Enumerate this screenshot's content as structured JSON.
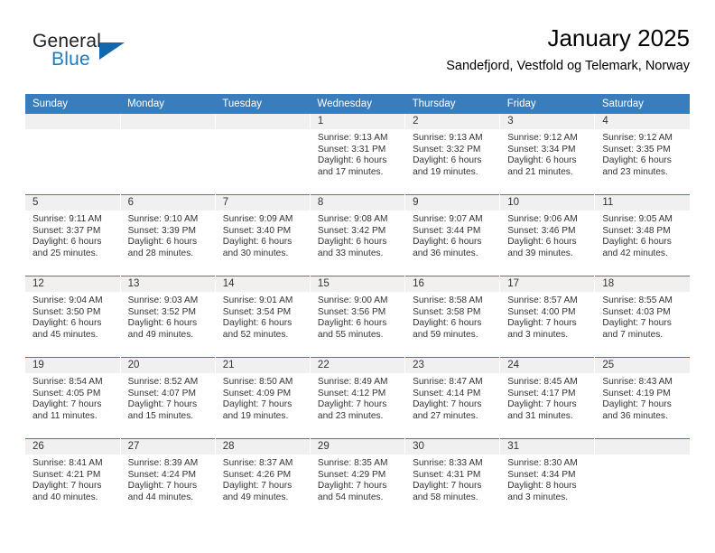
{
  "logo": {
    "text_primary": "General",
    "text_secondary": "Blue",
    "icon": "triangle-icon",
    "color_primary": "#231f20",
    "color_secondary": "#1b7bc4",
    "color_triangle": "#1267ad"
  },
  "header": {
    "title": "January 2025",
    "subtitle": "Sandefjord, Vestfold og Telemark, Norway"
  },
  "theme": {
    "header_bar": "#3a7dbd",
    "daynum_band": "#f0f0f0",
    "text": "#333333"
  },
  "weekday_headers": [
    "Sunday",
    "Monday",
    "Tuesday",
    "Wednesday",
    "Thursday",
    "Friday",
    "Saturday"
  ],
  "weeks": [
    [
      {
        "day": "",
        "sunrise": "",
        "sunset": "",
        "daylight_line1": "",
        "daylight_line2": ""
      },
      {
        "day": "",
        "sunrise": "",
        "sunset": "",
        "daylight_line1": "",
        "daylight_line2": ""
      },
      {
        "day": "",
        "sunrise": "",
        "sunset": "",
        "daylight_line1": "",
        "daylight_line2": ""
      },
      {
        "day": "1",
        "sunrise": "Sunrise: 9:13 AM",
        "sunset": "Sunset: 3:31 PM",
        "daylight_line1": "Daylight: 6 hours",
        "daylight_line2": "and 17 minutes."
      },
      {
        "day": "2",
        "sunrise": "Sunrise: 9:13 AM",
        "sunset": "Sunset: 3:32 PM",
        "daylight_line1": "Daylight: 6 hours",
        "daylight_line2": "and 19 minutes."
      },
      {
        "day": "3",
        "sunrise": "Sunrise: 9:12 AM",
        "sunset": "Sunset: 3:34 PM",
        "daylight_line1": "Daylight: 6 hours",
        "daylight_line2": "and 21 minutes."
      },
      {
        "day": "4",
        "sunrise": "Sunrise: 9:12 AM",
        "sunset": "Sunset: 3:35 PM",
        "daylight_line1": "Daylight: 6 hours",
        "daylight_line2": "and 23 minutes."
      }
    ],
    [
      {
        "day": "5",
        "sunrise": "Sunrise: 9:11 AM",
        "sunset": "Sunset: 3:37 PM",
        "daylight_line1": "Daylight: 6 hours",
        "daylight_line2": "and 25 minutes."
      },
      {
        "day": "6",
        "sunrise": "Sunrise: 9:10 AM",
        "sunset": "Sunset: 3:39 PM",
        "daylight_line1": "Daylight: 6 hours",
        "daylight_line2": "and 28 minutes."
      },
      {
        "day": "7",
        "sunrise": "Sunrise: 9:09 AM",
        "sunset": "Sunset: 3:40 PM",
        "daylight_line1": "Daylight: 6 hours",
        "daylight_line2": "and 30 minutes."
      },
      {
        "day": "8",
        "sunrise": "Sunrise: 9:08 AM",
        "sunset": "Sunset: 3:42 PM",
        "daylight_line1": "Daylight: 6 hours",
        "daylight_line2": "and 33 minutes."
      },
      {
        "day": "9",
        "sunrise": "Sunrise: 9:07 AM",
        "sunset": "Sunset: 3:44 PM",
        "daylight_line1": "Daylight: 6 hours",
        "daylight_line2": "and 36 minutes."
      },
      {
        "day": "10",
        "sunrise": "Sunrise: 9:06 AM",
        "sunset": "Sunset: 3:46 PM",
        "daylight_line1": "Daylight: 6 hours",
        "daylight_line2": "and 39 minutes."
      },
      {
        "day": "11",
        "sunrise": "Sunrise: 9:05 AM",
        "sunset": "Sunset: 3:48 PM",
        "daylight_line1": "Daylight: 6 hours",
        "daylight_line2": "and 42 minutes."
      }
    ],
    [
      {
        "day": "12",
        "sunrise": "Sunrise: 9:04 AM",
        "sunset": "Sunset: 3:50 PM",
        "daylight_line1": "Daylight: 6 hours",
        "daylight_line2": "and 45 minutes."
      },
      {
        "day": "13",
        "sunrise": "Sunrise: 9:03 AM",
        "sunset": "Sunset: 3:52 PM",
        "daylight_line1": "Daylight: 6 hours",
        "daylight_line2": "and 49 minutes."
      },
      {
        "day": "14",
        "sunrise": "Sunrise: 9:01 AM",
        "sunset": "Sunset: 3:54 PM",
        "daylight_line1": "Daylight: 6 hours",
        "daylight_line2": "and 52 minutes."
      },
      {
        "day": "15",
        "sunrise": "Sunrise: 9:00 AM",
        "sunset": "Sunset: 3:56 PM",
        "daylight_line1": "Daylight: 6 hours",
        "daylight_line2": "and 55 minutes."
      },
      {
        "day": "16",
        "sunrise": "Sunrise: 8:58 AM",
        "sunset": "Sunset: 3:58 PM",
        "daylight_line1": "Daylight: 6 hours",
        "daylight_line2": "and 59 minutes."
      },
      {
        "day": "17",
        "sunrise": "Sunrise: 8:57 AM",
        "sunset": "Sunset: 4:00 PM",
        "daylight_line1": "Daylight: 7 hours",
        "daylight_line2": "and 3 minutes."
      },
      {
        "day": "18",
        "sunrise": "Sunrise: 8:55 AM",
        "sunset": "Sunset: 4:03 PM",
        "daylight_line1": "Daylight: 7 hours",
        "daylight_line2": "and 7 minutes."
      }
    ],
    [
      {
        "day": "19",
        "sunrise": "Sunrise: 8:54 AM",
        "sunset": "Sunset: 4:05 PM",
        "daylight_line1": "Daylight: 7 hours",
        "daylight_line2": "and 11 minutes."
      },
      {
        "day": "20",
        "sunrise": "Sunrise: 8:52 AM",
        "sunset": "Sunset: 4:07 PM",
        "daylight_line1": "Daylight: 7 hours",
        "daylight_line2": "and 15 minutes."
      },
      {
        "day": "21",
        "sunrise": "Sunrise: 8:50 AM",
        "sunset": "Sunset: 4:09 PM",
        "daylight_line1": "Daylight: 7 hours",
        "daylight_line2": "and 19 minutes."
      },
      {
        "day": "22",
        "sunrise": "Sunrise: 8:49 AM",
        "sunset": "Sunset: 4:12 PM",
        "daylight_line1": "Daylight: 7 hours",
        "daylight_line2": "and 23 minutes."
      },
      {
        "day": "23",
        "sunrise": "Sunrise: 8:47 AM",
        "sunset": "Sunset: 4:14 PM",
        "daylight_line1": "Daylight: 7 hours",
        "daylight_line2": "and 27 minutes."
      },
      {
        "day": "24",
        "sunrise": "Sunrise: 8:45 AM",
        "sunset": "Sunset: 4:17 PM",
        "daylight_line1": "Daylight: 7 hours",
        "daylight_line2": "and 31 minutes."
      },
      {
        "day": "25",
        "sunrise": "Sunrise: 8:43 AM",
        "sunset": "Sunset: 4:19 PM",
        "daylight_line1": "Daylight: 7 hours",
        "daylight_line2": "and 36 minutes."
      }
    ],
    [
      {
        "day": "26",
        "sunrise": "Sunrise: 8:41 AM",
        "sunset": "Sunset: 4:21 PM",
        "daylight_line1": "Daylight: 7 hours",
        "daylight_line2": "and 40 minutes."
      },
      {
        "day": "27",
        "sunrise": "Sunrise: 8:39 AM",
        "sunset": "Sunset: 4:24 PM",
        "daylight_line1": "Daylight: 7 hours",
        "daylight_line2": "and 44 minutes."
      },
      {
        "day": "28",
        "sunrise": "Sunrise: 8:37 AM",
        "sunset": "Sunset: 4:26 PM",
        "daylight_line1": "Daylight: 7 hours",
        "daylight_line2": "and 49 minutes."
      },
      {
        "day": "29",
        "sunrise": "Sunrise: 8:35 AM",
        "sunset": "Sunset: 4:29 PM",
        "daylight_line1": "Daylight: 7 hours",
        "daylight_line2": "and 54 minutes."
      },
      {
        "day": "30",
        "sunrise": "Sunrise: 8:33 AM",
        "sunset": "Sunset: 4:31 PM",
        "daylight_line1": "Daylight: 7 hours",
        "daylight_line2": "and 58 minutes."
      },
      {
        "day": "31",
        "sunrise": "Sunrise: 8:30 AM",
        "sunset": "Sunset: 4:34 PM",
        "daylight_line1": "Daylight: 8 hours",
        "daylight_line2": "and 3 minutes."
      },
      {
        "day": "",
        "sunrise": "",
        "sunset": "",
        "daylight_line1": "",
        "daylight_line2": ""
      }
    ]
  ]
}
